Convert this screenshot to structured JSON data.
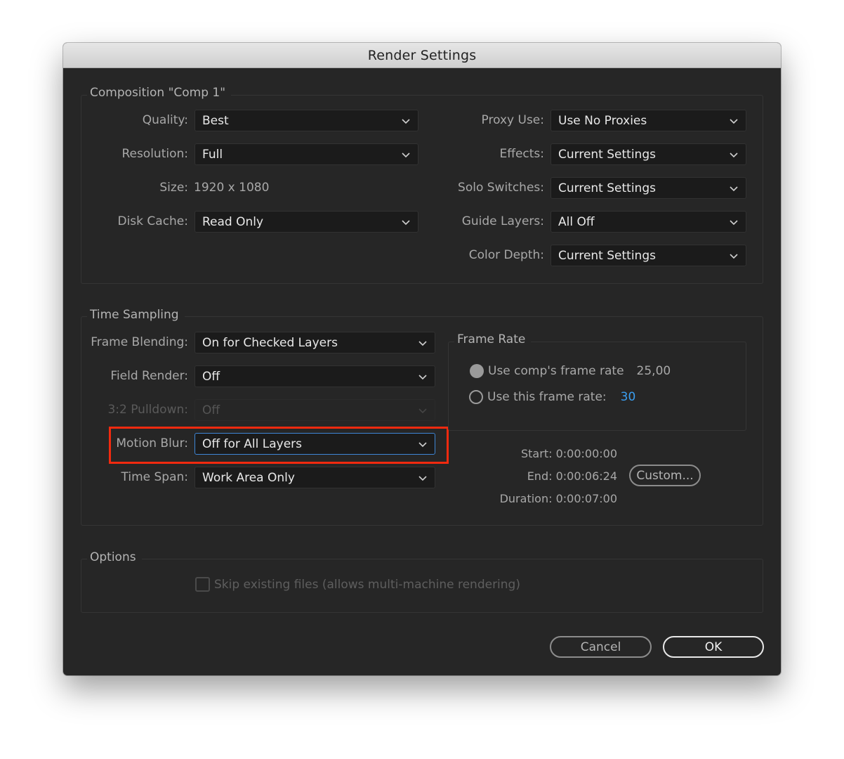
{
  "window": {
    "title": "Render Settings"
  },
  "composition": {
    "title": "Composition \"Comp 1\"",
    "quality": {
      "label": "Quality:",
      "value": "Best"
    },
    "resolution": {
      "label": "Resolution:",
      "value": "Full"
    },
    "size": {
      "label": "Size:",
      "value": "1920 x 1080"
    },
    "disk_cache": {
      "label": "Disk Cache:",
      "value": "Read Only"
    },
    "proxy_use": {
      "label": "Proxy Use:",
      "value": "Use No Proxies"
    },
    "effects": {
      "label": "Effects:",
      "value": "Current Settings"
    },
    "solo_switches": {
      "label": "Solo Switches:",
      "value": "Current Settings"
    },
    "guide_layers": {
      "label": "Guide Layers:",
      "value": "All Off"
    },
    "color_depth": {
      "label": "Color Depth:",
      "value": "Current Settings"
    }
  },
  "time_sampling": {
    "title": "Time Sampling",
    "frame_blending": {
      "label": "Frame Blending:",
      "value": "On for Checked Layers"
    },
    "field_render": {
      "label": "Field Render:",
      "value": "Off"
    },
    "pulldown": {
      "label": "3:2 Pulldown:",
      "value": "Off",
      "disabled": true
    },
    "motion_blur": {
      "label": "Motion Blur:",
      "value": "Off for All Layers",
      "highlighted": true
    },
    "time_span": {
      "label": "Time Span:",
      "value": "Work Area Only"
    },
    "frame_rate": {
      "title": "Frame Rate",
      "comp_rate": {
        "label": "Use comp's frame rate",
        "value": "25,00",
        "selected": true
      },
      "custom_rate": {
        "label": "Use this frame rate:",
        "value": "30",
        "selected": false
      }
    },
    "start": "Start: 0:00:00:00",
    "end": "End: 0:00:06:24",
    "duration": "Duration: 0:00:07:00",
    "custom_button": "Custom..."
  },
  "options": {
    "title": "Options",
    "skip_existing": {
      "label": "Skip existing files (allows multi-machine rendering)",
      "checked": false,
      "disabled": true
    }
  },
  "buttons": {
    "cancel": "Cancel",
    "ok": "OK"
  },
  "colors": {
    "accent_focus": "#3e86d6",
    "highlight": "#f12a0f",
    "link_value": "#3a9ef0"
  }
}
